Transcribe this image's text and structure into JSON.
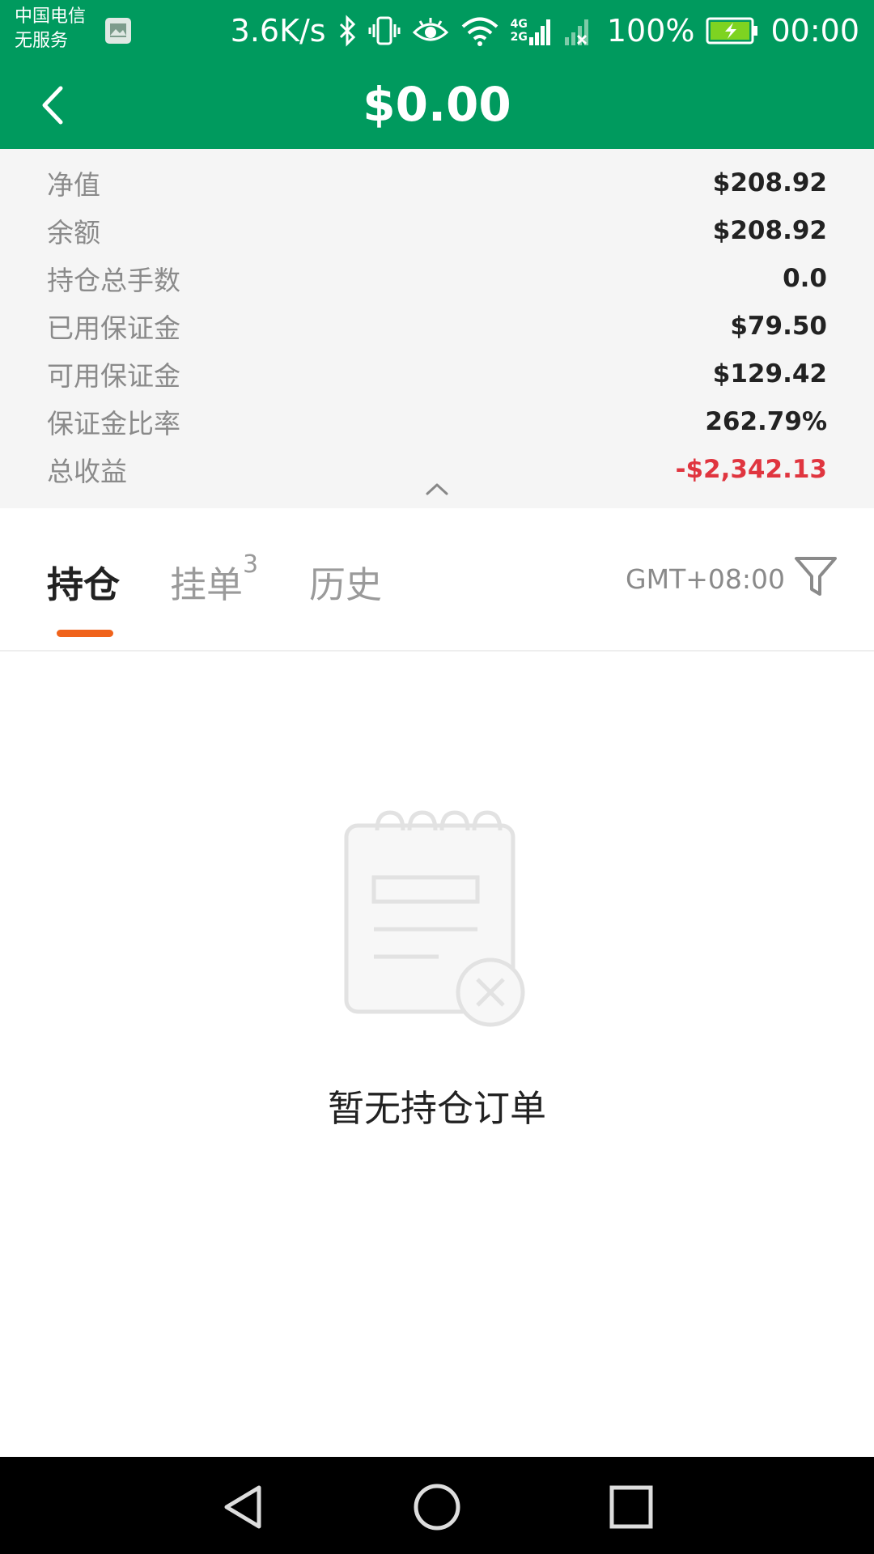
{
  "status_bar": {
    "carrier_line1": "中国电信",
    "carrier_line2": "无服务",
    "net_speed": "3.6K/s",
    "network_type_top": "4G",
    "network_type_bottom": "2G",
    "battery": "100%",
    "time": "00:00",
    "icons": [
      "gallery-icon",
      "bluetooth-icon",
      "vibrate-icon",
      "eye-icon",
      "wifi-icon",
      "signal-icon",
      "no-signal-icon",
      "battery-charging-icon"
    ]
  },
  "header": {
    "title": "$0.00",
    "back_icon": "chevron-left-icon"
  },
  "summary": {
    "rows": [
      {
        "label": "净值",
        "value": "$208.92"
      },
      {
        "label": "余额",
        "value": "$208.92"
      },
      {
        "label": "持仓总手数",
        "value": "0.0"
      },
      {
        "label": "已用保证金",
        "value": "$79.50"
      },
      {
        "label": "可用保证金",
        "value": "$129.42"
      },
      {
        "label": "保证金比率",
        "value": "262.79%"
      },
      {
        "label": "总收益",
        "value": "-$2,342.13"
      }
    ],
    "collapse_icon": "chevron-up-icon"
  },
  "tabs": {
    "items": [
      {
        "label": "持仓",
        "badge": ""
      },
      {
        "label": "挂单",
        "badge": "3"
      },
      {
        "label": "历史",
        "badge": ""
      }
    ],
    "active_index": 0,
    "accent_color": "#f0631b",
    "timezone": "GMT+08:00",
    "filter_icon": "filter-icon"
  },
  "empty_state": {
    "icon": "empty-notebook-icon",
    "text": "暂无持仓订单"
  },
  "colors": {
    "brand_green": "#009a5e",
    "negative_red": "#e0353f"
  },
  "nav_bar": {
    "icons": [
      "nav-back-icon",
      "nav-home-icon",
      "nav-recents-icon"
    ]
  }
}
